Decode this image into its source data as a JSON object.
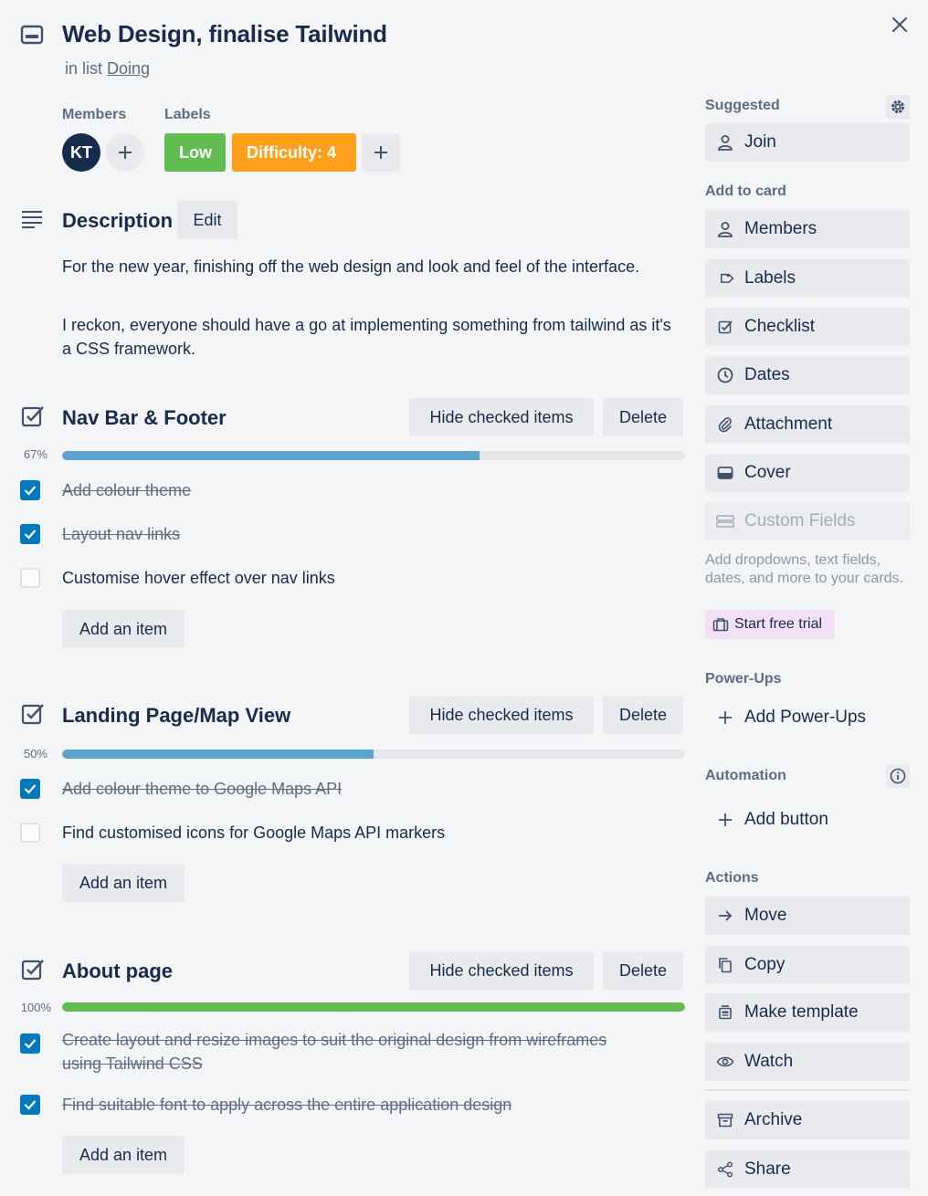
{
  "card": {
    "title": "Web Design, finalise Tailwind",
    "in_list_prefix": "in list",
    "list_name": "Doing"
  },
  "members": {
    "heading": "Members",
    "avatar_initials": "KT"
  },
  "labels": {
    "heading": "Labels",
    "items": [
      {
        "text": "Low",
        "color": "#61bd4f"
      },
      {
        "text": "Difficulty: 4",
        "color": "#ff9f1a"
      }
    ]
  },
  "description": {
    "heading": "Description",
    "edit_label": "Edit",
    "paragraphs": [
      "For the new year, finishing off the web design and look and feel of the interface.",
      "I reckon, everyone should have a go at implementing something from tailwind as it's a CSS framework."
    ]
  },
  "checklists": [
    {
      "title": "Nav Bar & Footer",
      "percent_label": "67%",
      "progress": 0.67,
      "hide_label": "Hide checked items",
      "delete_label": "Delete",
      "add_label": "Add an item",
      "items": [
        {
          "text": "Add colour theme",
          "checked": true
        },
        {
          "text": "Layout nav links",
          "checked": true
        },
        {
          "text": "Customise hover effect over nav links",
          "checked": false
        }
      ]
    },
    {
      "title": "Landing Page/Map View",
      "percent_label": "50%",
      "progress": 0.5,
      "hide_label": "Hide checked items",
      "delete_label": "Delete",
      "add_label": "Add an item",
      "items": [
        {
          "text": "Add colour theme to Google Maps API",
          "checked": true
        },
        {
          "text": "Find customised icons for Google Maps API markers",
          "checked": false
        }
      ]
    },
    {
      "title": "About page",
      "percent_label": "100%",
      "progress": 1.0,
      "hide_label": "Hide checked items",
      "delete_label": "Delete",
      "add_label": "Add an item",
      "items": [
        {
          "text": "Create layout and resize images to suit the original design from wireframes using Tailwind CSS",
          "checked": true
        },
        {
          "text": "Find suitable font to apply across the entire application design",
          "checked": true
        }
      ]
    }
  ],
  "sidebar": {
    "suggested_heading": "Suggested",
    "join_label": "Join",
    "add_to_card_heading": "Add to card",
    "add_to_card": {
      "members": "Members",
      "labels": "Labels",
      "checklist": "Checklist",
      "dates": "Dates",
      "attachment": "Attachment",
      "cover": "Cover",
      "custom_fields": "Custom Fields"
    },
    "custom_fields_help": "Add dropdowns, text fields, dates, and more to your cards.",
    "trial_label": "Start free trial",
    "powerups_heading": "Power-Ups",
    "add_powerups_label": "Add Power-Ups",
    "automation_heading": "Automation",
    "add_button_label": "Add button",
    "actions_heading": "Actions",
    "actions": {
      "move": "Move",
      "copy": "Copy",
      "make_template": "Make template",
      "watch": "Watch",
      "archive": "Archive",
      "share": "Share"
    }
  },
  "colors": {
    "checked_blue": "#0079bf",
    "progress_blue": "#5ba4cf",
    "progress_green": "#61bd4f",
    "text_dark": "#172b4d",
    "text_muted": "#5e6c84"
  }
}
